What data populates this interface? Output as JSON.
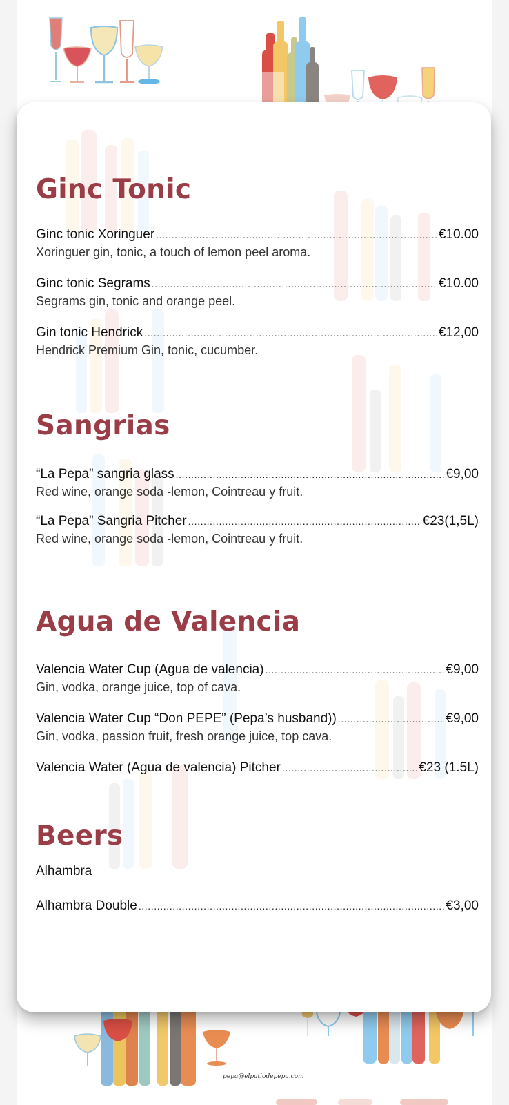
{
  "sections": [
    {
      "title": "Ginc Tonic",
      "items": [
        {
          "name": "Ginc tonic Xoringuer",
          "price": "€10.00",
          "desc": "Xoringuer gin, tonic, a touch of lemon peel aroma."
        },
        {
          "name": "Ginc tonic Segrams",
          "price": "€10.00",
          "desc": "Segrams gin, tonic and orange peel."
        },
        {
          "name": "Gin tonic Hendrick",
          "price": "€12,00",
          "desc": "Hendrick Premium Gin, tonic, cucumber."
        }
      ]
    },
    {
      "title": "Sangrias",
      "items": [
        {
          "name": "“La Pepa” sangria glass",
          "price": "€9,00",
          "desc": "Red wine, orange soda -lemon, Cointreau y fruit."
        },
        {
          "name": "“La Pepa” Sangria Pitcher",
          "price": "€23(1,5L)",
          "desc": "Red wine, orange soda -lemon, Cointreau y fruit."
        }
      ]
    },
    {
      "title": "Agua de Valencia",
      "items": [
        {
          "name": "Valencia Water Cup (Agua de valencia)",
          "price": "€9,00",
          "desc": "Gin, vodka, orange juice, top of cava."
        },
        {
          "name": "Valencia Water Cup “Don PEPE” (Pepa’s husband))",
          "price": "€9,00",
          "desc": "Gin, vodka, passion fruit, fresh orange juice, top cava."
        },
        {
          "name": "Valencia Water (Agua de valencia) Pitcher",
          "price": "€23 (1.5L)",
          "desc": ""
        }
      ]
    },
    {
      "title": "Beers",
      "items": [
        {
          "name": "Alhambra",
          "price": "",
          "desc": ""
        },
        {
          "name": "Alhambra Double",
          "price": "€3,00",
          "desc": ""
        }
      ]
    }
  ],
  "footer": {
    "email": "pepa@elpatiodepepa.com"
  },
  "colors": {
    "heading": "#9a3d47",
    "text": "#111111",
    "background": "#ffffff"
  }
}
